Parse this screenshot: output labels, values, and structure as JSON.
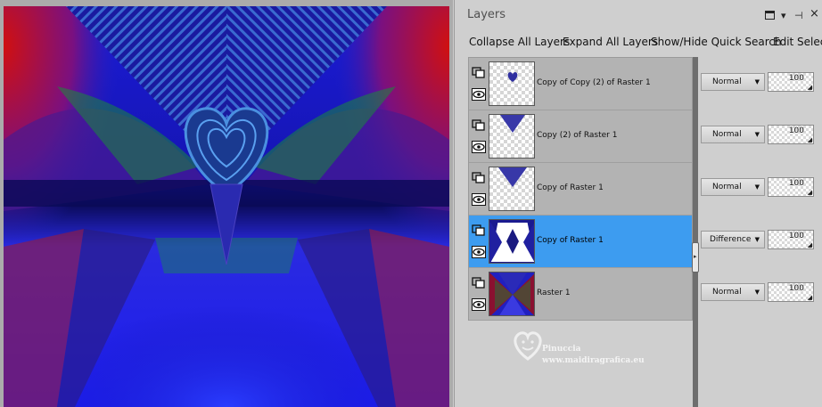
{
  "panel": {
    "title": "Layers",
    "toolbar": {
      "collapse_all": "Collapse All Layers",
      "expand_all": "Expand All Layers",
      "quick_search": "Show/Hide Quick Search",
      "edit_selection": "Edit Selection"
    }
  },
  "layers": [
    {
      "name": "Copy of Copy (2) of Raster 1",
      "blend_mode": "Normal",
      "opacity": "100",
      "selected": false,
      "thumbnail": "small-heart"
    },
    {
      "name": "Copy (2) of Raster 1",
      "blend_mode": "Normal",
      "opacity": "100",
      "selected": false,
      "thumbnail": "triangle"
    },
    {
      "name": "Copy of Raster 1",
      "blend_mode": "Normal",
      "opacity": "100",
      "selected": false,
      "thumbnail": "triangle"
    },
    {
      "name": "Copy of Raster 1",
      "blend_mode": "Difference",
      "opacity": "100",
      "selected": true,
      "thumbnail": "mirrored-pattern"
    },
    {
      "name": "Raster 1",
      "blend_mode": "Normal",
      "opacity": "100",
      "selected": false,
      "thumbnail": "kaleidoscope"
    }
  ],
  "watermark": {
    "name": "Pinuccia",
    "url": "www.maidiragrafica.eu"
  },
  "colors": {
    "selection": "#3d9cf0",
    "panel_bg": "#cfcfcf",
    "canvas_blue": "#1a1acc"
  },
  "icons": {
    "panel_menu": "panel-menu-icon",
    "dropdown": "chevron-down-icon",
    "pin": "pin-icon",
    "close": "close-icon",
    "visibility": "eye-icon",
    "mask": "mask-icon"
  }
}
